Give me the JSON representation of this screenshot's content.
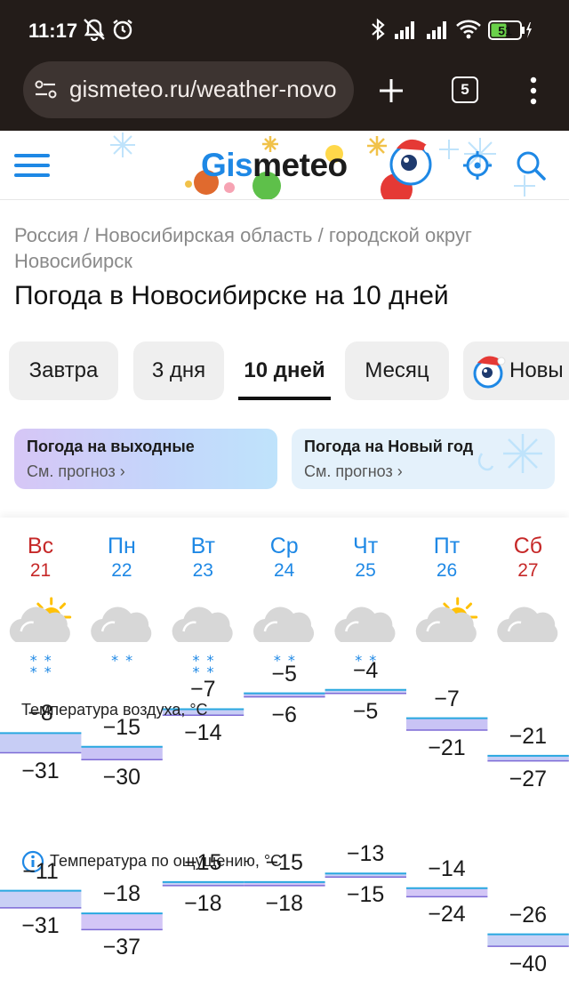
{
  "status": {
    "time": "11:17",
    "battery": "51"
  },
  "browser": {
    "url": "gismeteo.ru/weather-novo",
    "tabs_count": "5"
  },
  "site": {
    "logo_a": "Gis",
    "logo_b": "meteo"
  },
  "breadcrumb": "Россия / Новосибирская область / городской округ Новосибирск",
  "title": "Погода в Новосибирске на 10 дней",
  "tabs": [
    "Завтра",
    "3 дня",
    "10 дней",
    "Месяц",
    "Новы"
  ],
  "promos": [
    {
      "title": "Погода на выходные",
      "sub": "См. прогноз"
    },
    {
      "title": "Погода на Новый год",
      "sub": "См. прогноз"
    }
  ],
  "days": [
    {
      "name": "Вс",
      "date": "21",
      "weekend": true,
      "sun": true,
      "snow": 2
    },
    {
      "name": "Пн",
      "date": "22",
      "weekend": false,
      "sun": false,
      "snow": 1
    },
    {
      "name": "Вт",
      "date": "23",
      "weekend": false,
      "sun": false,
      "snow": 2
    },
    {
      "name": "Ср",
      "date": "24",
      "weekend": false,
      "sun": false,
      "snow": 1
    },
    {
      "name": "Чт",
      "date": "25",
      "weekend": false,
      "sun": false,
      "snow": 1
    },
    {
      "name": "Пт",
      "date": "26",
      "weekend": false,
      "sun": true,
      "snow": 0
    },
    {
      "name": "Сб",
      "date": "27",
      "weekend": true,
      "sun": false,
      "snow": 0
    }
  ],
  "air_label": "Температура воздуха, °C",
  "feel_label": "Температура по ощущению, °C",
  "air": {
    "max": [
      -8,
      -15,
      -7,
      -5,
      -4,
      -7,
      -21
    ],
    "min": [
      -31,
      -30,
      -14,
      -6,
      -5,
      -21,
      -27
    ],
    "max_text": [
      "−8",
      "−15",
      "−7",
      "−5",
      "−4",
      "−7",
      "−21"
    ],
    "min_text": [
      "−31",
      "−30",
      "−14",
      "−6",
      "−5",
      "−21",
      "−27"
    ]
  },
  "feel": {
    "max": [
      -11,
      -18,
      -15,
      -15,
      -13,
      -14,
      -26
    ],
    "min": [
      -31,
      -37,
      -18,
      -18,
      -15,
      -24,
      -40
    ],
    "max_text": [
      "−11",
      "−18",
      "−15",
      "−15",
      "−13",
      "−14",
      "−26"
    ],
    "min_text": [
      "−31",
      "−37",
      "−18",
      "−18",
      "−15",
      "−24",
      "−40"
    ]
  },
  "colors": {
    "weekend": "#c62828",
    "weekday": "#1e88e5",
    "accent": "#1e88e5"
  }
}
